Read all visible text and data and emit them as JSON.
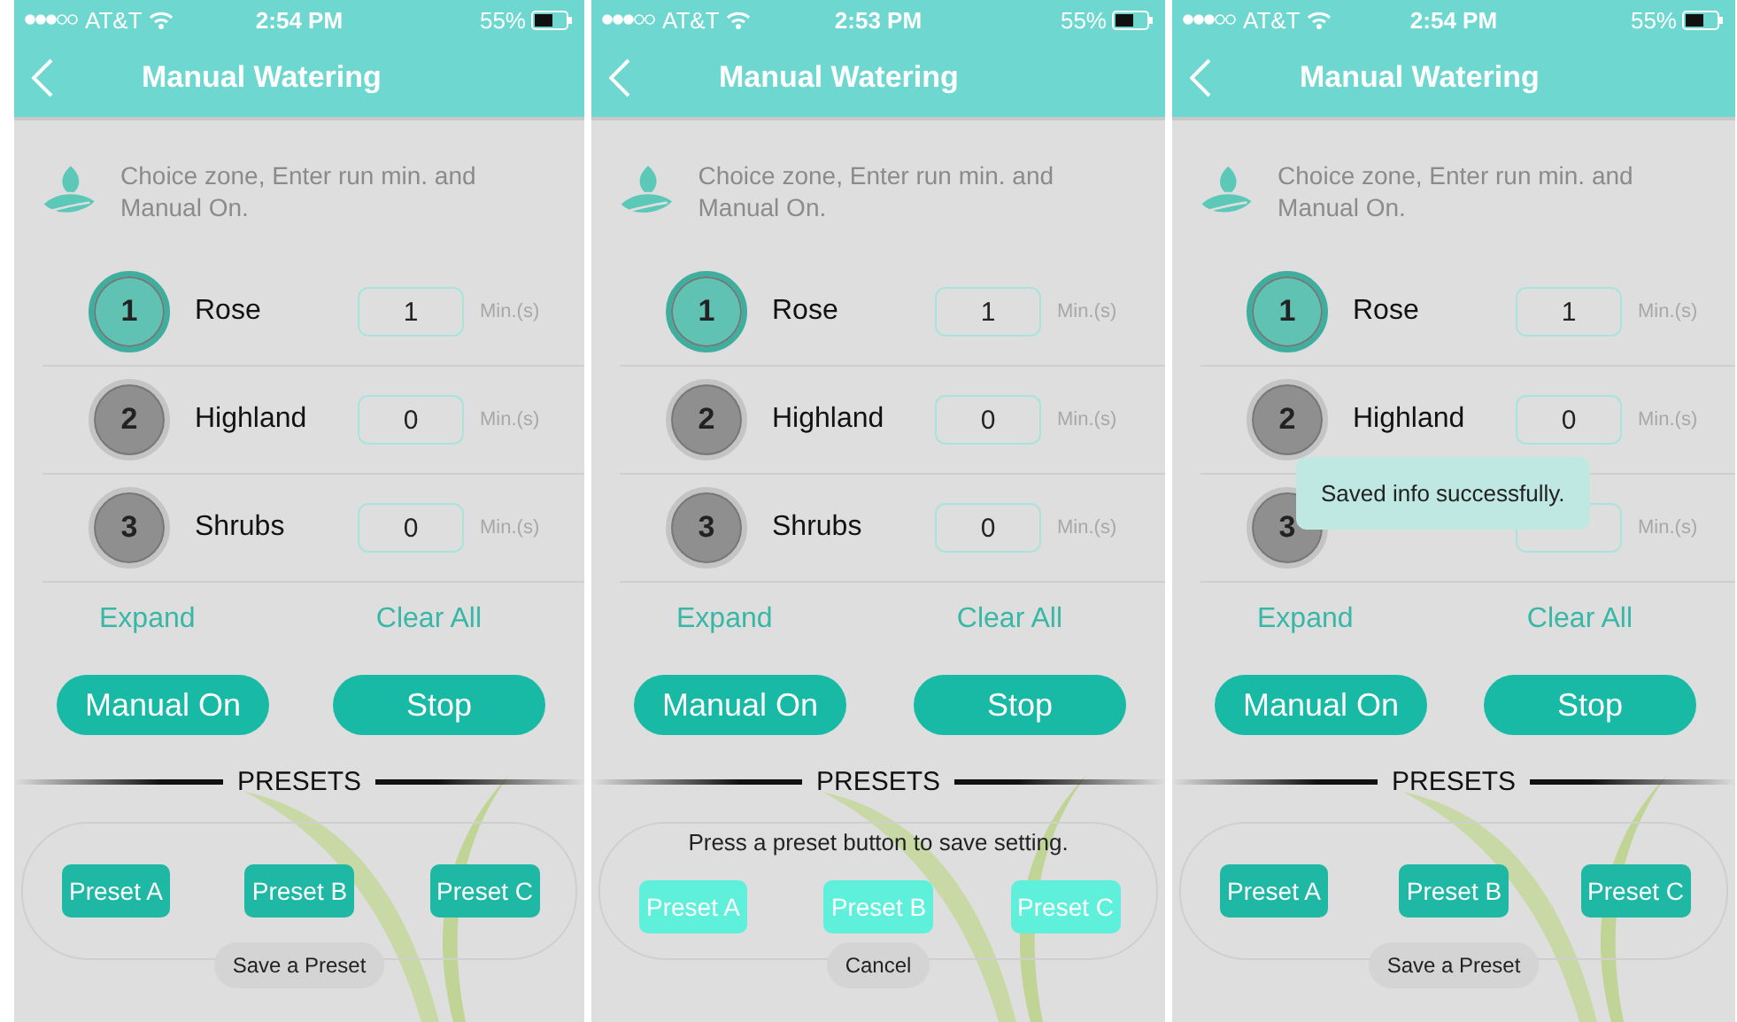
{
  "screens": [
    {
      "status": {
        "carrier": "AT&T",
        "time": "2:54 PM",
        "battery": "55%"
      },
      "title": "Manual Watering",
      "hint": "Choice zone, Enter run min. and Manual On.",
      "zones": [
        {
          "number": "1",
          "name": "Rose",
          "value": "1",
          "unit": "Min.(s)",
          "selected": true
        },
        {
          "number": "2",
          "name": "Highland",
          "value": "0",
          "unit": "Min.(s)",
          "selected": false
        },
        {
          "number": "3",
          "name": "Shrubs",
          "value": "0",
          "unit": "Min.(s)",
          "selected": false
        }
      ],
      "links": [
        "Expand",
        "Clear All"
      ],
      "actions": [
        "Manual On",
        "Stop"
      ],
      "presets_heading": "PRESETS",
      "presets": [
        {
          "label": "Preset A",
          "highlighted": false
        },
        {
          "label": "Preset B",
          "highlighted": false
        },
        {
          "label": "Preset C",
          "highlighted": false
        }
      ],
      "preset_button": "Save a Preset"
    },
    {
      "status": {
        "carrier": "AT&T",
        "time": "2:53 PM",
        "battery": "55%"
      },
      "title": "Manual Watering",
      "hint": "Choice zone, Enter run min. and Manual On.",
      "zones": [
        {
          "number": "1",
          "name": "Rose",
          "value": "1",
          "unit": "Min.(s)",
          "selected": true
        },
        {
          "number": "2",
          "name": "Highland",
          "value": "0",
          "unit": "Min.(s)",
          "selected": false
        },
        {
          "number": "3",
          "name": "Shrubs",
          "value": "0",
          "unit": "Min.(s)",
          "selected": false
        }
      ],
      "links": [
        "Expand",
        "Clear All"
      ],
      "actions": [
        "Manual On",
        "Stop"
      ],
      "presets_heading": "PRESETS",
      "preset_prompt": "Press a preset button to save setting.",
      "presets": [
        {
          "label": "Preset A",
          "highlighted": true
        },
        {
          "label": "Preset B",
          "highlighted": true
        },
        {
          "label": "Preset C",
          "highlighted": true
        }
      ],
      "preset_button": "Cancel"
    },
    {
      "status": {
        "carrier": "AT&T",
        "time": "2:54 PM",
        "battery": "55%"
      },
      "title": "Manual Watering",
      "hint": "Choice zone, Enter run min. and Manual On.",
      "zones": [
        {
          "number": "1",
          "name": "Rose",
          "value": "1",
          "unit": "Min.(s)",
          "selected": true
        },
        {
          "number": "2",
          "name": "Highland",
          "value": "0",
          "unit": "Min.(s)",
          "selected": false
        },
        {
          "number": "3",
          "unit": "Min.(s)",
          "selected": false
        }
      ],
      "toast": "Saved info successfully.",
      "links": [
        "Expand",
        "Clear All"
      ],
      "actions": [
        "Manual On",
        "Stop"
      ],
      "presets_heading": "PRESETS",
      "presets": [
        {
          "label": "Preset A",
          "highlighted": false
        },
        {
          "label": "Preset B",
          "highlighted": false
        },
        {
          "label": "Preset C",
          "highlighted": false
        }
      ],
      "preset_button": "Save a Preset"
    }
  ]
}
